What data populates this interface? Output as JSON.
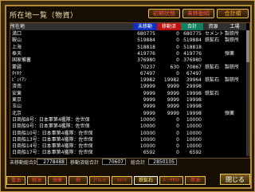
{
  "title": "所在地一覧（物資）",
  "top_buttons": {
    "initial": "初期状態",
    "unmoved": "未移動順",
    "total": "合計順"
  },
  "columns": {
    "location": "所在地",
    "unmoved": "未移動",
    "moved": "移動済",
    "total": "合計",
    "resource": "資源",
    "factory": "工場"
  },
  "rows": [
    {
      "loc": "満口",
      "unmoved": "680775",
      "moved": "0",
      "total": "680775",
      "res": "セメント",
      "fac": "製鉄所"
    },
    {
      "loc": "鞍山",
      "unmoved": "519884",
      "moved": "0",
      "total": "519884",
      "res": "鉄鉱石",
      "fac": "製鉄所"
    },
    {
      "loc": "上海",
      "unmoved": "518818",
      "moved": "0",
      "total": "518818",
      "res": "",
      "fac": ""
    },
    {
      "loc": "奉天",
      "unmoved": "419776",
      "moved": "0",
      "total": "419776",
      "res": "",
      "fac": "弾薬"
    },
    {
      "loc": "国家備蓄",
      "unmoved": "376980",
      "moved": "0",
      "total": "376980",
      "res": "",
      "fac": ""
    },
    {
      "loc": "蒙疆",
      "unmoved": "70237",
      "moved": "630",
      "total": "70867",
      "res": "鉄鉱石",
      "fac": "製鉄所"
    },
    {
      "loc": "ﾀｲﾎｸ",
      "unmoved": "67497",
      "moved": "0",
      "total": "67497",
      "res": "",
      "fac": ""
    },
    {
      "loc": "ﾋﾟｭｲｱﾝ",
      "unmoved": "19982",
      "moved": "19982",
      "total": "39964",
      "res": "鉄鉱石",
      "fac": "製鉄所"
    },
    {
      "loc": "済南",
      "unmoved": "19999",
      "moved": "9999",
      "total": "29998",
      "res": "",
      "fac": ""
    },
    {
      "loc": "安東",
      "unmoved": "9999",
      "moved": "9999",
      "total": "19998",
      "res": "鉄鉱石",
      "fac": ""
    },
    {
      "loc": "東京",
      "unmoved": "9999",
      "moved": "9999",
      "total": "19998",
      "res": "",
      "fac": ""
    },
    {
      "loc": "玉山",
      "unmoved": "9999",
      "moved": "9999",
      "total": "19998",
      "res": "",
      "fac": ""
    },
    {
      "loc": "北京",
      "unmoved": "9999",
      "moved": "9999",
      "total": "19998",
      "res": "",
      "fac": "弾薬"
    },
    {
      "loc": "日商船8号：日本軍第4艦隊：佐世保",
      "unmoved": "10000",
      "moved": "0",
      "total": "10000",
      "res": "",
      "fac": ""
    },
    {
      "loc": "日商船9号：日本軍第4艦隊：佐世保",
      "unmoved": "10000",
      "moved": "0",
      "total": "10000",
      "res": "",
      "fac": ""
    },
    {
      "loc": "日商船10号：日本軍第4艦隊：佐世保",
      "unmoved": "10000",
      "moved": "0",
      "total": "10000",
      "res": "",
      "fac": ""
    },
    {
      "loc": "日商船13号：日本軍第4艦隊：佐世保",
      "unmoved": "10000",
      "moved": "0",
      "total": "10000",
      "res": "",
      "fac": ""
    },
    {
      "loc": "日商船14号：日本軍第4艦隊：佐世保",
      "unmoved": "10000",
      "moved": "0",
      "total": "10000",
      "res": "",
      "fac": ""
    },
    {
      "loc": "日商船17号：日本軍第4艦隊：佐世保",
      "unmoved": "6592",
      "moved": "0",
      "total": "6592",
      "res": "",
      "fac": ""
    }
  ],
  "footer": {
    "unmoved_total_label": "未移動総合計",
    "unmoved_total": "2778488",
    "moved_total_label": "移動済総合計",
    "moved_total": "70607",
    "grand_total_label": "総合計",
    "grand_total": "2850105"
  },
  "resource_buttons": [
    "重油",
    "軽油",
    "弾薬",
    "鉄",
    "アルミ",
    "ｾﾒﾝﾄ",
    "鉄鉱石",
    "ﾎﾞｰｷｻｲﾄ",
    "原油"
  ],
  "close_label": "閉じる"
}
